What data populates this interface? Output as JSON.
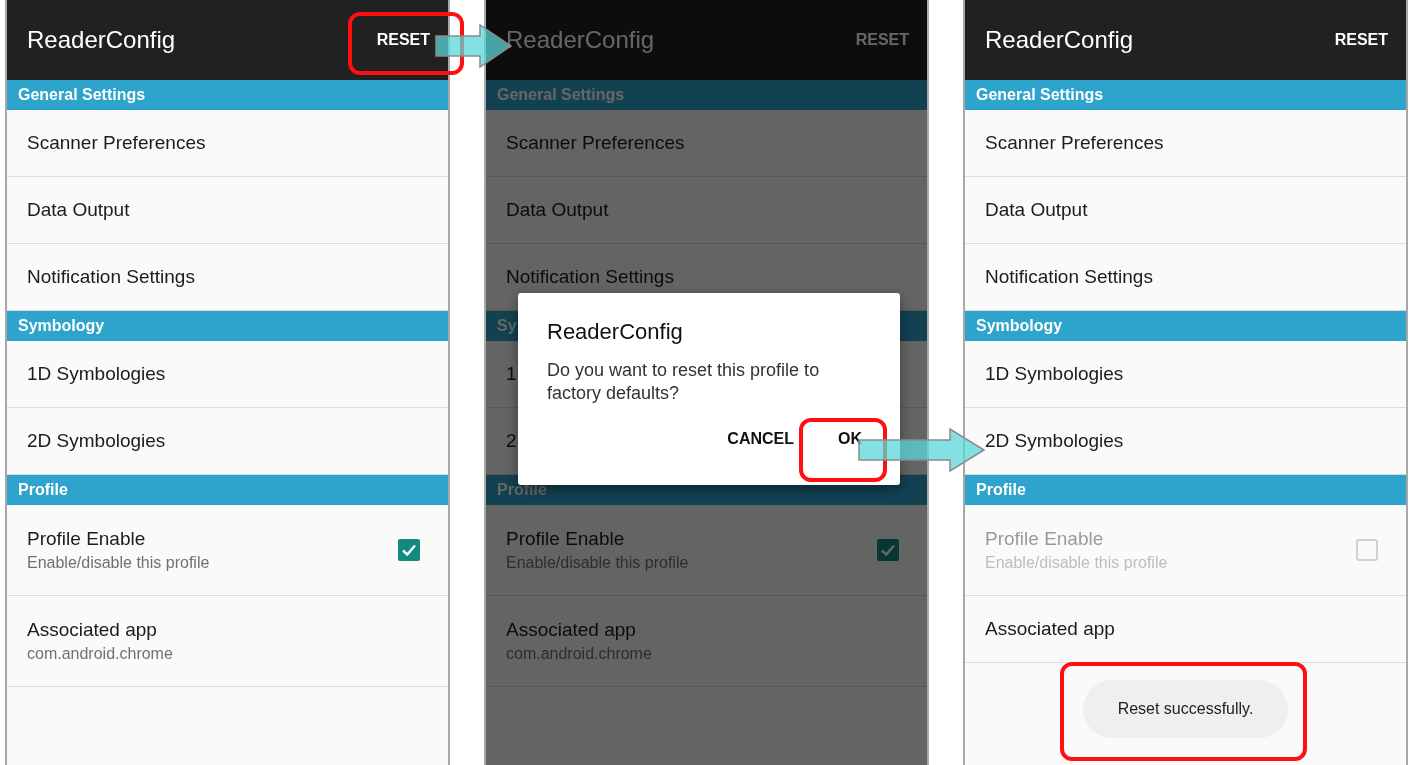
{
  "screens": [
    {
      "title": "ReaderConfig",
      "action": "RESET",
      "dimmed": false,
      "sections": [
        {
          "header": "General Settings",
          "items": [
            {
              "kind": "text",
              "title": "Scanner Preferences",
              "disabled": false
            },
            {
              "kind": "text",
              "title": "Data Output",
              "disabled": false
            },
            {
              "kind": "text",
              "title": "Notification Settings",
              "disabled": false
            }
          ]
        },
        {
          "header": "Symbology",
          "items": [
            {
              "kind": "text",
              "title": "1D Symbologies",
              "disabled": false
            },
            {
              "kind": "text",
              "title": "2D Symbologies",
              "disabled": false
            }
          ]
        },
        {
          "header": "Profile",
          "items": [
            {
              "kind": "checkbox",
              "title": "Profile Enable",
              "subtitle": "Enable/disable this profile",
              "checked": true,
              "disabled": false
            },
            {
              "kind": "text",
              "title": "Associated app",
              "subtitle": "com.android.chrome",
              "disabled": false
            }
          ]
        }
      ]
    },
    {
      "title": "ReaderConfig",
      "action": "RESET",
      "dimmed": true,
      "sections": [
        {
          "header": "General Settings",
          "items": [
            {
              "kind": "text",
              "title": "Scanner Preferences",
              "disabled": false
            },
            {
              "kind": "text",
              "title": "Data Output",
              "disabled": false
            },
            {
              "kind": "text",
              "title": "Notification Settings",
              "disabled": false
            }
          ]
        },
        {
          "header": "Sy",
          "items": [
            {
              "kind": "text",
              "title": "1",
              "disabled": false
            },
            {
              "kind": "text",
              "title": "2",
              "disabled": false
            }
          ]
        },
        {
          "header": "Profile",
          "items": [
            {
              "kind": "checkbox",
              "title": "Profile Enable",
              "subtitle": "Enable/disable this profile",
              "checked": true,
              "disabled": false
            },
            {
              "kind": "text",
              "title": "Associated app",
              "subtitle": "com.android.chrome",
              "disabled": false
            }
          ]
        }
      ],
      "dialog": {
        "title": "ReaderConfig",
        "message": "Do you want to reset this profile to factory defaults?",
        "buttons": [
          "CANCEL",
          "OK"
        ]
      }
    },
    {
      "title": "ReaderConfig",
      "action": "RESET",
      "dimmed": false,
      "sections": [
        {
          "header": "General Settings",
          "items": [
            {
              "kind": "text",
              "title": "Scanner Preferences",
              "disabled": false
            },
            {
              "kind": "text",
              "title": "Data Output",
              "disabled": false
            },
            {
              "kind": "text",
              "title": "Notification Settings",
              "disabled": false
            }
          ]
        },
        {
          "header": "Symbology",
          "items": [
            {
              "kind": "text",
              "title": "1D Symbologies",
              "disabled": false
            },
            {
              "kind": "text",
              "title": "2D Symbologies",
              "disabled": false
            }
          ]
        },
        {
          "header": "Profile",
          "items": [
            {
              "kind": "checkbox",
              "title": "Profile Enable",
              "subtitle": "Enable/disable this profile",
              "checked": false,
              "disabled": true
            },
            {
              "kind": "text",
              "title": "Associated app",
              "disabled": false
            }
          ]
        }
      ],
      "toast": "Reset successfully."
    }
  ]
}
